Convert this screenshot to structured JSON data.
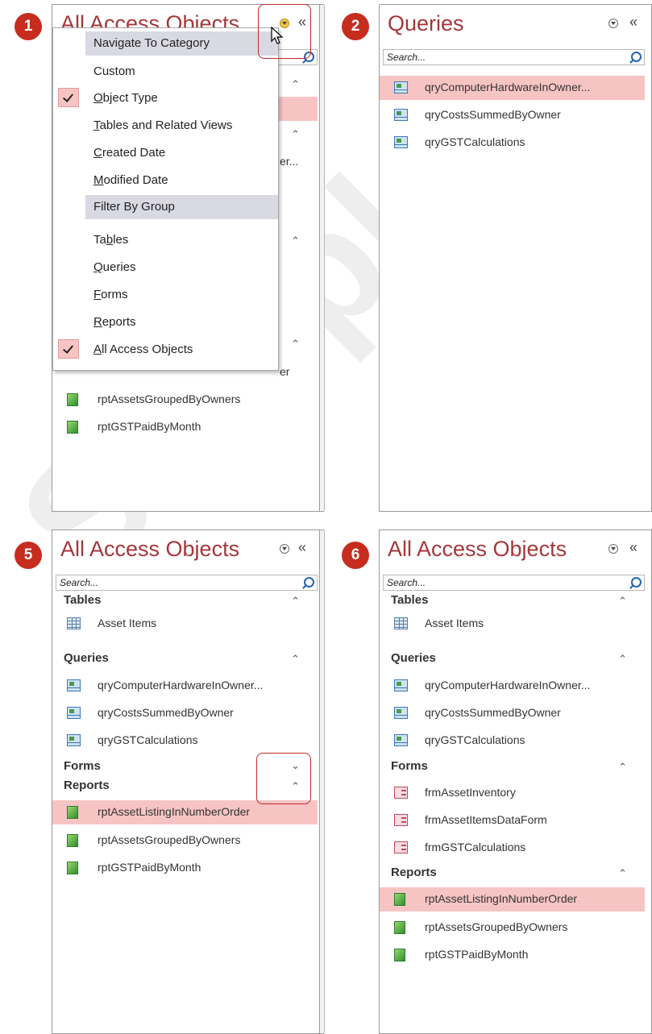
{
  "panes": {
    "p1": {
      "badge": "1",
      "title": "All Access Objects",
      "shutter": "«",
      "menu": {
        "header1": "Navigate To Category",
        "custom": "Custom",
        "object_type_pre": "",
        "object_type_u": "O",
        "object_type_post": "bject Type",
        "tables_related_pre": "",
        "tables_related_u": "T",
        "tables_related_post": "ables and Related Views",
        "created_pre": "",
        "created_u": "C",
        "created_post": "reated Date",
        "modified_pre": "",
        "modified_u": "M",
        "modified_post": "odified Date",
        "header2": "Filter By Group",
        "tables_pre": "Ta",
        "tables_u": "b",
        "tables_post": "les",
        "queries_pre": "",
        "queries_u": "Q",
        "queries_post": "ueries",
        "forms_pre": "",
        "forms_u": "F",
        "forms_post": "orms",
        "reports_pre": "",
        "reports_u": "R",
        "reports_post": "eports",
        "all_pre": "",
        "all_u": "A",
        "all_post": "ll Access Objects"
      },
      "peek1": "er...",
      "peek2": "er",
      "items": [
        "rptAssetsGroupedByOwners",
        "rptGSTPaidByMonth"
      ]
    },
    "p2": {
      "badge": "2",
      "title": "Queries",
      "shutter": "«",
      "search_placeholder": "Search...",
      "items": [
        "qryComputerHardwareInOwner...",
        "qryCostsSummedByOwner",
        "qryGSTCalculations"
      ]
    },
    "p5": {
      "badge": "5",
      "title": "All Access Objects",
      "shutter": "«",
      "search_placeholder": "Search...",
      "groups": {
        "tables": "Tables",
        "queries": "Queries",
        "forms": "Forms",
        "reports": "Reports"
      },
      "tables": [
        "Asset Items"
      ],
      "queries": [
        "qryComputerHardwareInOwner...",
        "qryCostsSummedByOwner",
        "qryGSTCalculations"
      ],
      "reports": [
        "rptAssetListingInNumberOrder",
        "rptAssetsGroupedByOwners",
        "rptGSTPaidByMonth"
      ]
    },
    "p6": {
      "badge": "6",
      "title": "All Access Objects",
      "shutter": "«",
      "search_placeholder": "Search...",
      "groups": {
        "tables": "Tables",
        "queries": "Queries",
        "forms": "Forms",
        "reports": "Reports"
      },
      "tables": [
        "Asset Items"
      ],
      "queries": [
        "qryComputerHardwareInOwner...",
        "qryCostsSummedByOwner",
        "qryGSTCalculations"
      ],
      "forms": [
        "frmAssetInventory",
        "frmAssetItemsDataForm",
        "frmGSTCalculations"
      ],
      "reports": [
        "rptAssetListingInNumberOrder",
        "rptAssetsGroupedByOwners",
        "rptGSTPaidByMonth"
      ]
    }
  },
  "icons": {
    "dropdown": "chevron-down-circle-icon",
    "collapse": "double-chevron-up-icon",
    "expand": "double-chevron-down-icon",
    "shutter": "double-chevron-left-icon"
  },
  "colors": {
    "title": "#a4373a",
    "badge": "#c62d1f",
    "selection": "#f7c4c4",
    "menu_header": "#d9d9e4"
  }
}
